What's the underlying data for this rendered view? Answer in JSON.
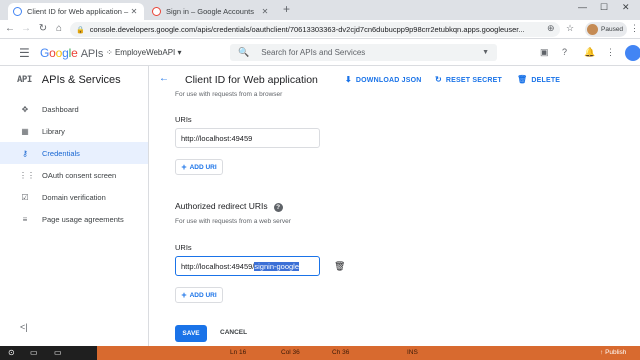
{
  "browser": {
    "tabs": [
      {
        "title": "Client ID for Web application – A",
        "active": true
      },
      {
        "title": "Sign in – Google Accounts",
        "active": false
      }
    ],
    "new_tab_icon": "plus-icon",
    "url": "console.developers.google.com/apis/credentials/oauthclient/70613303363-dv2cjd7cn6dubucpp9p98crr2etubkqn.apps.googleuser...",
    "profile_label": "Paused"
  },
  "console": {
    "logo_google": "Google",
    "logo_apis": "APIs",
    "project_name": "EmployeWebAPI",
    "search_placeholder": "Search for APIs and Services"
  },
  "sidebar": {
    "badge": "API",
    "title": "APIs & Services",
    "items": [
      {
        "label": "Dashboard",
        "icon": "dashboard-icon",
        "selected": false
      },
      {
        "label": "Library",
        "icon": "library-icon",
        "selected": false
      },
      {
        "label": "Credentials",
        "icon": "key-icon",
        "selected": true
      },
      {
        "label": "OAuth consent screen",
        "icon": "consent-icon",
        "selected": false
      },
      {
        "label": "Domain verification",
        "icon": "checkbox-icon",
        "selected": false
      },
      {
        "label": "Page usage agreements",
        "icon": "settings-list-icon",
        "selected": false
      }
    ]
  },
  "main": {
    "page_title": "Client ID for Web application",
    "actions": {
      "download": "DOWNLOAD JSON",
      "reset": "RESET SECRET",
      "delete": "DELETE"
    },
    "origins": {
      "cut_subtitle": "For use with requests from a browser",
      "uris_label": "URIs",
      "uri_value": "http://localhost:49459",
      "add_uri": "ADD URI"
    },
    "redirect": {
      "title": "Authorized redirect URIs",
      "subtitle": "For use with requests from a web server",
      "uris_label": "URIs",
      "uri_prefix": "http://localhost:49459/",
      "uri_selected": "signin-google",
      "add_uri": "ADD URI"
    },
    "save_label": "SAVE",
    "cancel_label": "CANCEL"
  },
  "taskbar": {
    "ln": "Ln 16",
    "col": "Col 36",
    "ch": "Ch 36",
    "ins": "INS",
    "publish": "Publish"
  },
  "colors": {
    "accent": "#1a73e8",
    "selected_bg": "#e8f0fe",
    "taskbar": "#d86a2f"
  }
}
